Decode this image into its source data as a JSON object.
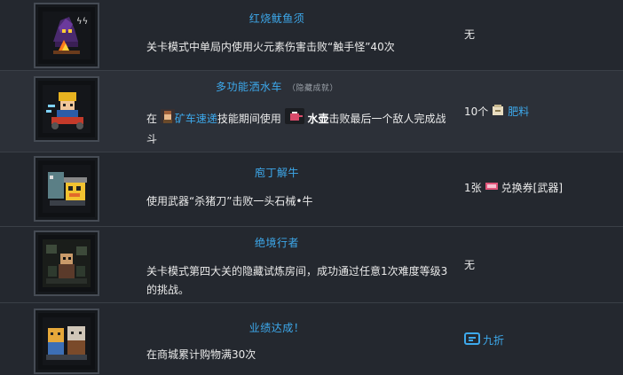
{
  "achievements": [
    {
      "title": "红烧鱿鱼须",
      "tag": "",
      "desc_plain": "关卡模式中单局内使用火元素伤害击败“触手怪”40次",
      "reward_text": "无"
    },
    {
      "title": "多功能洒水车",
      "tag": "（隐藏成就）",
      "desc_pre": "在",
      "desc_skill": "矿车速递",
      "desc_mid": "技能期间使用",
      "desc_item": "水壶",
      "desc_post": "击败最后一个敌人完成战斗",
      "reward_count": "10个",
      "reward_item": "肥料"
    },
    {
      "title": "庖丁解牛",
      "tag": "",
      "desc_plain": "使用武器“杀猪刀”击败一头石械•牛",
      "reward_count": "1张",
      "reward_item": "兑换券[武器]"
    },
    {
      "title": "绝境行者",
      "tag": "",
      "desc_plain": "关卡模式第四大关的隐藏试炼房间，成功通过任意1次难度等级3的挑战。",
      "reward_text": "无"
    },
    {
      "title": "业绩达成！",
      "tag": "",
      "desc_plain": "在商城累计购物满30次",
      "reward_item": "九折"
    }
  ],
  "colors": {
    "accent": "#3da9ec",
    "bg": "#24282f",
    "row_alt": "#2c3038"
  },
  "icons": [
    "squid-wizard-icon",
    "miner-sprinkler-icon",
    "knight-bull-icon",
    "cave-walker-icon",
    "shopper-pair-icon"
  ]
}
